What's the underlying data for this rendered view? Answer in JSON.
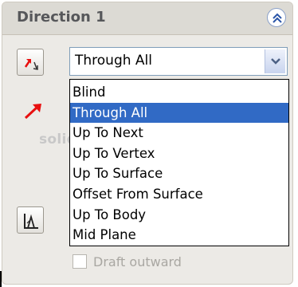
{
  "section": {
    "title": "Direction 1"
  },
  "end_condition": {
    "selected": "Through All",
    "options": [
      "Blind",
      "Through All",
      "Up To Next",
      "Up To Vertex",
      "Up To Surface",
      "Offset From Surface",
      "Up To Body",
      "Mid Plane"
    ]
  },
  "watermark": "solidworkstutorials.com",
  "draft": {
    "label": "Draft outward",
    "checked": false
  },
  "colors": {
    "selection": "#316ac5",
    "arrow_red": "#e81010",
    "panel_bg": "#eceae6"
  }
}
